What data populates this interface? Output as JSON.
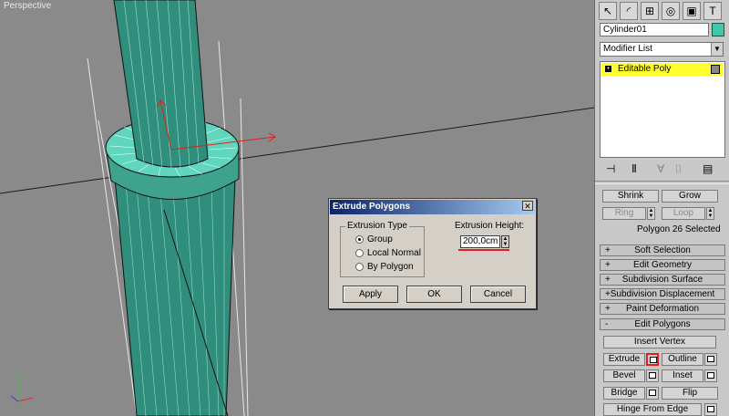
{
  "viewport": {
    "label": "Perspective",
    "background": "#8a8a8a",
    "object_color": "#2f8f7c"
  },
  "panel": {
    "toolbar_icons": [
      "create-icon",
      "modify-icon",
      "hierarchy-icon",
      "motion-icon",
      "display-icon",
      "utilities-icon"
    ],
    "object_name": "Cylinder01",
    "object_color": "#40c8a8",
    "modifier_list": "Modifier List",
    "stack_item": "Editable Poly",
    "selection": {
      "shrink": "Shrink",
      "grow": "Grow",
      "ring": "Ring",
      "loop": "Loop",
      "status": "Polygon 26 Selected"
    },
    "rollouts": [
      {
        "sign": "+",
        "label": "Soft Selection"
      },
      {
        "sign": "+",
        "label": "Edit Geometry"
      },
      {
        "sign": "+",
        "label": "Subdivision Surface"
      },
      {
        "sign": "+",
        "label": "Subdivision Displacement"
      },
      {
        "sign": "+",
        "label": "Paint Deformation"
      },
      {
        "sign": "-",
        "label": "Edit Polygons"
      }
    ],
    "edit_polygons": {
      "insert_vertex": "Insert Vertex",
      "extrude": "Extrude",
      "outline": "Outline",
      "bevel": "Bevel",
      "inset": "Inset",
      "bridge": "Bridge",
      "flip": "Flip",
      "hinge": "Hinge From Edge"
    }
  },
  "dialog": {
    "title": "Extrude Polygons",
    "extrusion_type_label": "Extrusion Type",
    "options": [
      "Group",
      "Local Normal",
      "By Polygon"
    ],
    "selected_option": "Group",
    "height_label": "Extrusion Height:",
    "height_value": "200,0cm",
    "apply": "Apply",
    "ok": "OK",
    "cancel": "Cancel",
    "highlight": "#e02020"
  }
}
